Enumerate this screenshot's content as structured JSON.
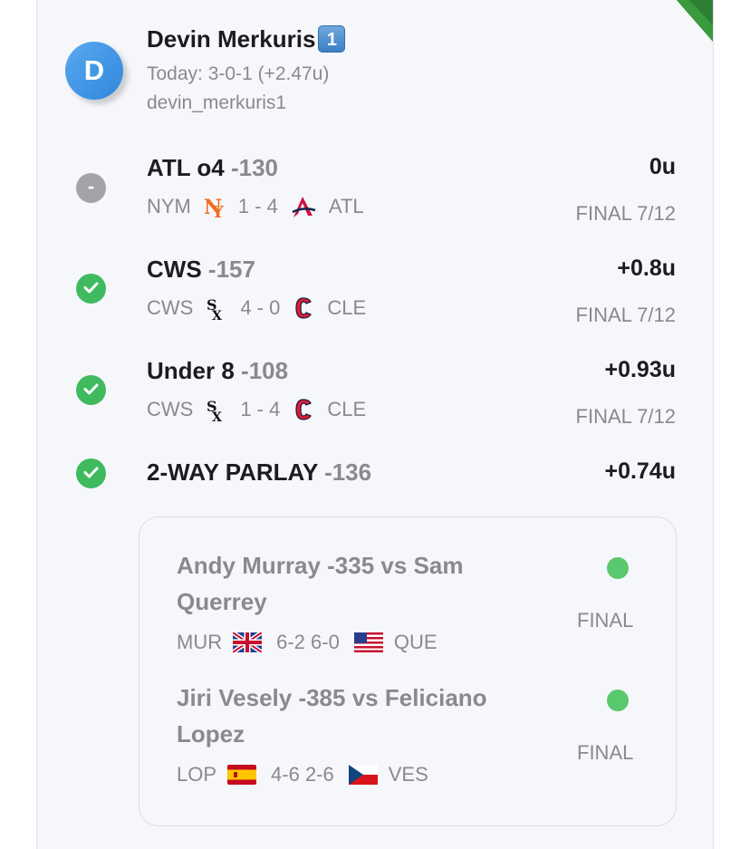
{
  "user": {
    "avatar_letter": "D",
    "name": "Devin Merkuris",
    "badge": "1",
    "today_record": "Today: 3-0-1 (+2.47u)",
    "handle": "devin_merkuris1"
  },
  "picks": [
    {
      "status": "push",
      "status_symbol": "-",
      "pick": "ATL o4",
      "odds": "-130",
      "result": "0u",
      "away": "NYM",
      "away_logo": "mets-logo-icon",
      "score": "1 - 4",
      "home": "ATL",
      "home_logo": "braves-logo-icon",
      "final": "FINAL 7/12"
    },
    {
      "status": "win",
      "pick": "CWS",
      "odds": "-157",
      "result": "+0.8u",
      "away": "CWS",
      "away_logo": "white-sox-logo-icon",
      "score": "4 - 0",
      "home": "CLE",
      "home_logo": "cleveland-logo-icon",
      "final": "FINAL 7/12"
    },
    {
      "status": "win",
      "pick": "Under 8",
      "odds": "-108",
      "result": "+0.93u",
      "away": "CWS",
      "away_logo": "white-sox-logo-icon",
      "score": "1 - 4",
      "home": "CLE",
      "home_logo": "cleveland-logo-icon",
      "final": "FINAL 7/12"
    }
  ],
  "parlay": {
    "status": "win",
    "title": "2-WAY PARLAY",
    "odds": "-136",
    "result": "+0.74u",
    "legs": [
      {
        "title": "Andy Murray -335 vs Sam Querrey",
        "p1": "MUR",
        "p1_flag": "uk-flag-icon",
        "score": "6-2 6-0",
        "p2": "QUE",
        "p2_flag": "us-flag-icon",
        "final": "FINAL"
      },
      {
        "title": "Jiri Vesely -385 vs Feliciano Lopez",
        "p1": "LOP",
        "p1_flag": "spain-flag-icon",
        "score": "4-6 2-6",
        "p2": "VES",
        "p2_flag": "czech-flag-icon",
        "final": "FINAL"
      }
    ]
  },
  "colors": {
    "win": "#3fba5f",
    "push": "#a3a3a8",
    "muted_text": "#8a8a8e",
    "primary_text": "#1c1c1e",
    "card_bg": "#f6f7fb",
    "avatar_blue": "#2f86dc"
  }
}
